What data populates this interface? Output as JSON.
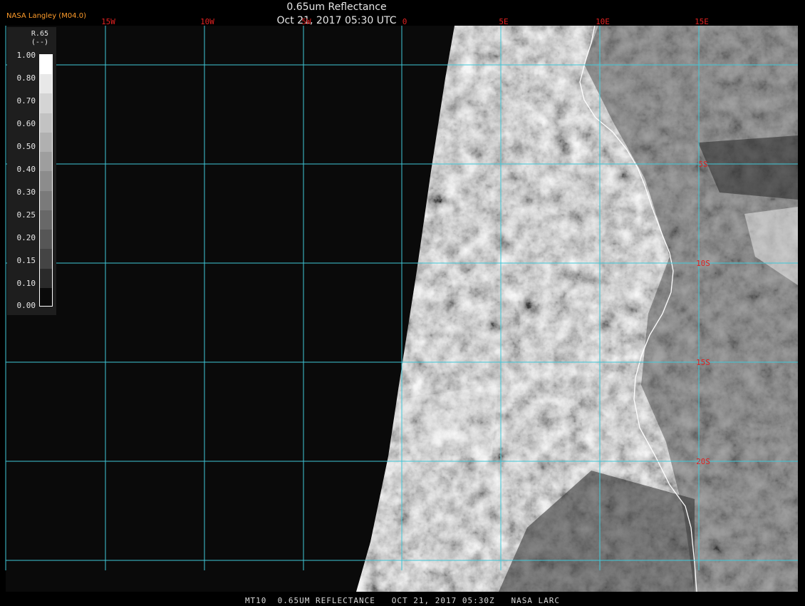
{
  "header": {
    "title": "0.65um Reflectance",
    "timestamp": "Oct 21, 2017 05:30 UTC",
    "brand": "NASA Langley (M04.0)"
  },
  "footer": {
    "caption": "MT10  0.65UM REFLECTANCE   OCT 21, 2017 05:30Z   NASA LARC"
  },
  "legend": {
    "code": "R.65",
    "unit": "(--)",
    "ticks": [
      "1.00",
      "0.80",
      "0.70",
      "0.60",
      "0.50",
      "0.40",
      "0.30",
      "0.25",
      "0.20",
      "0.15",
      "0.10",
      "0.00"
    ],
    "band_colors": [
      "#ffffff",
      "#e8e8e8",
      "#d4d4d4",
      "#c2c2c2",
      "#b0b0b0",
      "#9e9e9e",
      "#8c8c8c",
      "#7a7a7a",
      "#686868",
      "#565656",
      "#444444",
      "#2a2a2a",
      "#0a0a0a"
    ]
  },
  "map": {
    "lon_labels": [
      "15W",
      "10W",
      "5W",
      "0",
      "5E",
      "10E",
      "15E"
    ],
    "lat_labels": [
      "5S",
      "10S",
      "15S",
      "20S"
    ],
    "colors": {
      "grid": "#40c8d8",
      "label": "#e02020",
      "coast": "#ffffff",
      "space": "#0a0a0a"
    }
  }
}
